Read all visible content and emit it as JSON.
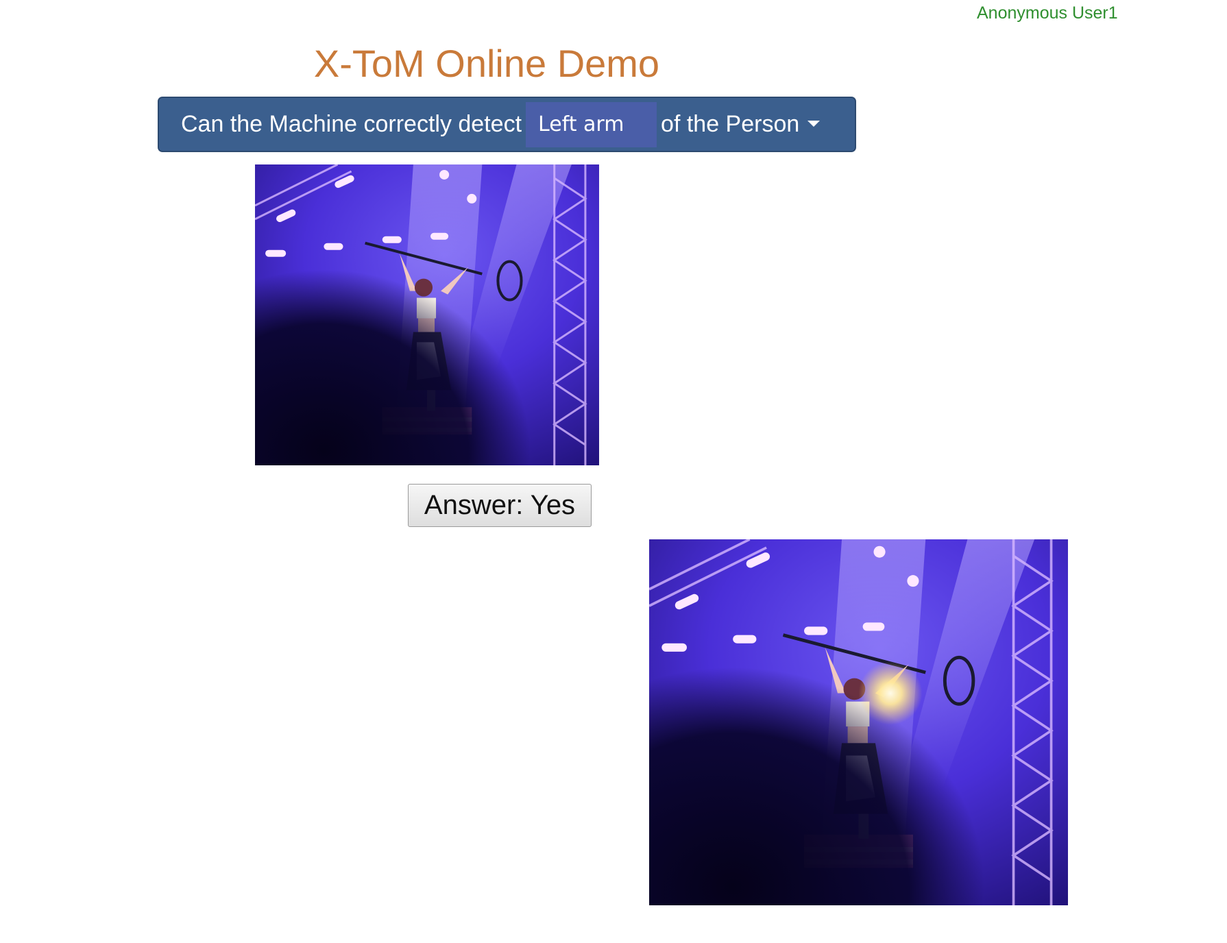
{
  "header": {
    "user_label": "Anonymous User1"
  },
  "main": {
    "title": "X-ToM Online Demo",
    "question": {
      "prefix": "Can the Machine correctly detect",
      "selected_part": "Left arm",
      "suffix": "of the Person"
    },
    "answer_button_label": "Answer: Yes"
  },
  "colors": {
    "title": "#c97a3a",
    "user_label": "#2f8f2f",
    "question_bar": "#3b5f8e",
    "select_bg": "#4a5ea8"
  },
  "images": {
    "input_photo": "concert-performer-photo",
    "explanation_photo": "concert-performer-photo-with-highlight"
  }
}
